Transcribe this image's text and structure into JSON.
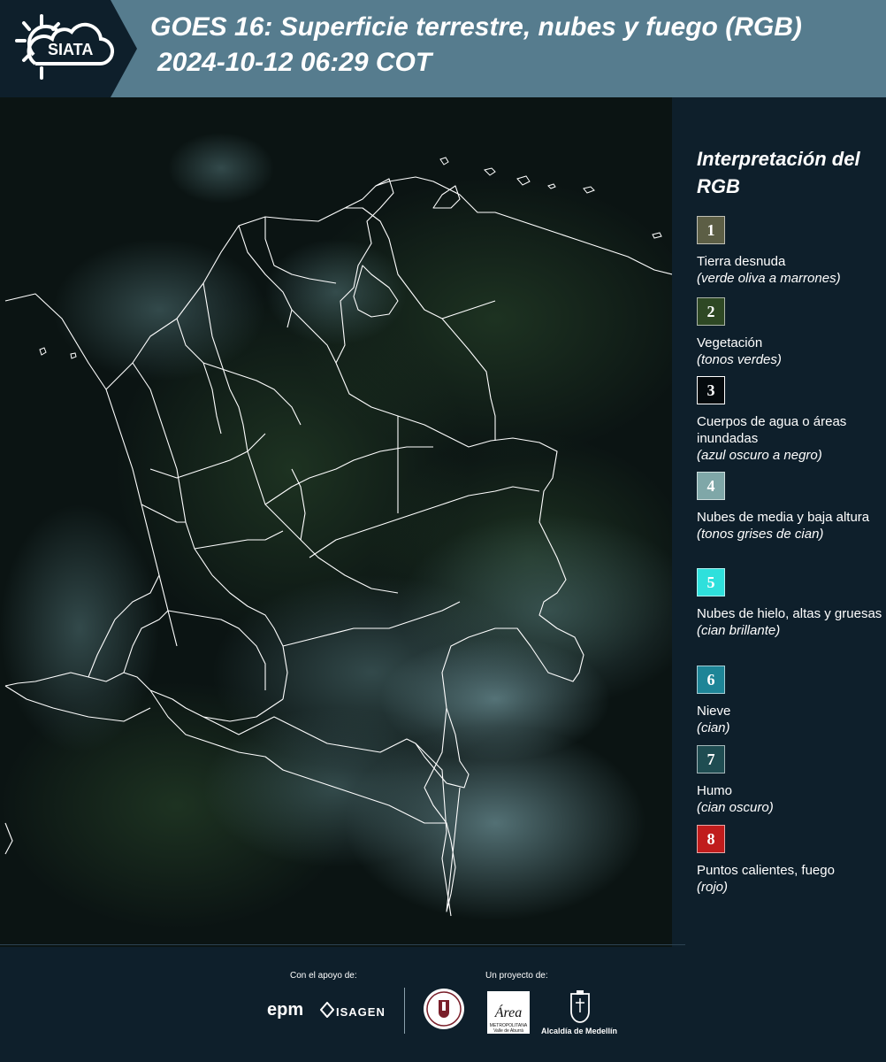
{
  "header": {
    "logo_text": "SIATA",
    "title_line1": "GOES 16: Superficie terrestre, nubes y fuego (RGB)",
    "title_line2": "2024-10-12 06:29 COT"
  },
  "map": {
    "description_icon": "map-icon"
  },
  "legend": {
    "title": "Interpretación del RGB",
    "items": [
      {
        "num": "1",
        "color": "#5c5e45",
        "label": "Tierra desnuda",
        "desc": "(verde oliva a marrones)"
      },
      {
        "num": "2",
        "color": "#2e4824",
        "label": "Vegetación",
        "desc": "(tonos verdes)"
      },
      {
        "num": "3",
        "color": "#050a0d",
        "label": "Cuerpos de agua o áreas inundadas",
        "desc": "(azul oscuro a negro)"
      },
      {
        "num": "4",
        "color": "#7fa7a8",
        "label": "Nubes de media y baja altura",
        "desc": "(tonos grises de cian)"
      },
      {
        "num": "5",
        "color": "#2ee0dc",
        "label": "Nubes de hielo, altas y gruesas",
        "desc": "(cian brillante)"
      },
      {
        "num": "6",
        "color": "#1e8597",
        "label": "Nieve",
        "desc": "(cian)"
      },
      {
        "num": "7",
        "color": "#1f4d52",
        "label": "Humo",
        "desc": "(cian oscuro)"
      },
      {
        "num": "8",
        "color": "#c01c1c",
        "label": "Puntos calientes, fuego",
        "desc": "(rojo)"
      }
    ]
  },
  "footer": {
    "support_label": "Con el apoyo de:",
    "project_label": "Un proyecto de:",
    "epm": "epm",
    "isagen": "ISAGEN",
    "area_main": "Área",
    "area_sub": "METROPOLITANA Valle de Aburrá",
    "alcaldia": "Alcaldía de Medellín"
  }
}
